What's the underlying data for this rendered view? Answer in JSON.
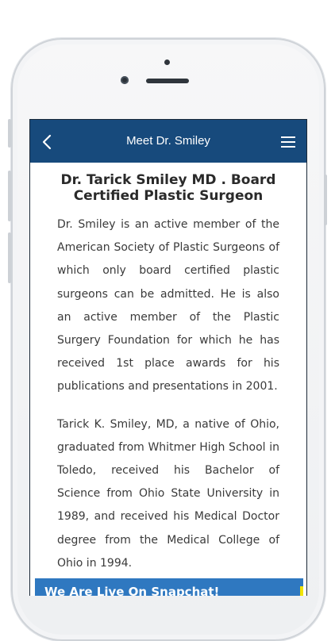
{
  "header": {
    "title": "Meet Dr. Smiley",
    "back_icon": "chevron-left-icon",
    "menu_icon": "hamburger-menu-icon"
  },
  "content": {
    "heading": "Dr. Tarick Smiley MD . Board Certified Plastic Surgeon",
    "paragraphs": [
      "Dr. Smiley is an active member of the American Society of Plastic Surgeons of which only board certified plastic surgeons can be admitted. He is also an active member of the Plastic Surgery Foundation for which he has received 1st place awards for his publications and presentations in 2001.",
      "Tarick K. Smiley, MD, a native of Ohio, graduated from Whitmer High School in Toledo, received his Bachelor of Science from Ohio State University in 1989, and received his Medical Doctor degree from the Medical College of Ohio in 1994."
    ]
  },
  "banner": {
    "text": "We Are Live On Snapchat!"
  },
  "colors": {
    "header_bg": "#174a7c",
    "banner_bg": "#2f78c0",
    "banner_accent": "#f2e400"
  }
}
